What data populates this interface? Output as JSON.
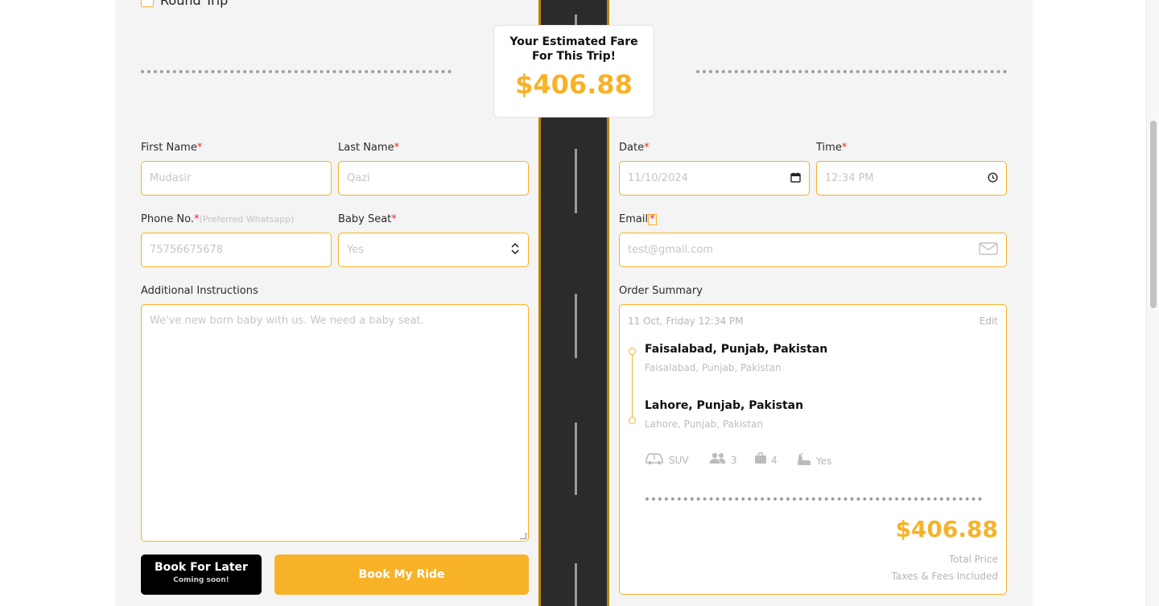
{
  "round_trip": {
    "label": "Round Trip"
  },
  "fare_card": {
    "title": "Your Estimated Fare\nFor This Trip!",
    "amount": "$406.88"
  },
  "form": {
    "first_name": {
      "label": "First Name",
      "required": "*",
      "value": "Mudasir"
    },
    "last_name": {
      "label": "Last Name",
      "required": "*",
      "value": "Qazi"
    },
    "phone": {
      "label": "Phone No.",
      "required": "*",
      "hint": "(Preferred Whatsapp)",
      "value": "75756675678"
    },
    "baby_seat": {
      "label": "Baby Seat",
      "required": "*",
      "value": "Yes"
    },
    "instructions": {
      "label": "Additional Instructions",
      "value": "We've new born baby with us. We need a baby seat."
    },
    "date": {
      "label": "Date",
      "required": "*",
      "value": "11/10/2024"
    },
    "time": {
      "label": "Time",
      "required": "*",
      "value": "12:34  PM"
    },
    "email": {
      "label": "Email",
      "required": "*",
      "value": "test@gmail.com"
    }
  },
  "buttons": {
    "book_later": "Book For Later",
    "book_later_sub": "Coming soon!",
    "book_ride": "Book My Ride"
  },
  "order_summary": {
    "label": "Order Summary",
    "datetime": "11 Oct, Friday 12:34 PM",
    "edit": "Edit",
    "pickup": {
      "title": "Faisalabad, Punjab, Pakistan",
      "subtitle": "Faisalabad, Punjab, Pakistan"
    },
    "dropoff": {
      "title": "Lahore, Punjab, Pakistan",
      "subtitle": "Lahore, Punjab, Pakistan"
    },
    "vehicle": "SUV",
    "passengers": "3",
    "luggage": "4",
    "baby_seat": "Yes",
    "total": "$406.88",
    "total_label": "Total Price",
    "tax_note": "Taxes & Fees Included"
  },
  "colors": {
    "accent": "#f7b228",
    "required": "#e52b2b",
    "panel_bg": "#f4f4f4",
    "road": "#2b2b2b"
  },
  "icons": [
    "calendar-icon",
    "clock-icon",
    "select-arrows-icon",
    "envelope-icon",
    "car-icon",
    "passengers-icon",
    "luggage-icon",
    "baby-seat-icon"
  ]
}
